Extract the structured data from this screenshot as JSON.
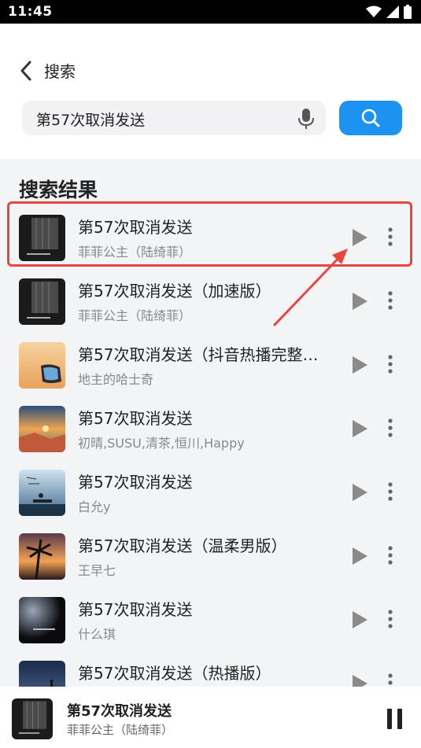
{
  "status_bar": {
    "time": "11:45"
  },
  "header": {
    "back_label": "搜索"
  },
  "search": {
    "query": "第57次取消发送"
  },
  "results_title": "搜索结果",
  "songs": [
    {
      "title": "第57次取消发送",
      "artist": "菲菲公主（陆绮菲）",
      "cover": "dark-window"
    },
    {
      "title": "第57次取消发送（加速版）",
      "artist": "菲菲公主（陆绮菲）",
      "cover": "dark-window"
    },
    {
      "title": "第57次取消发送（抖音热播完整…",
      "artist": "地主的哈士奇",
      "cover": "sunset-mirror"
    },
    {
      "title": "第57次取消发送",
      "artist": "初晴,SUSU,清茶,恒川,Happy",
      "cover": "sea-sunset"
    },
    {
      "title": "第57次取消发送",
      "artist": "白允y",
      "cover": "bench-sky"
    },
    {
      "title": "第57次取消发送（温柔男版）",
      "artist": "王早七",
      "cover": "palm-sunset"
    },
    {
      "title": "第57次取消发送",
      "artist": "什么琪",
      "cover": "dark-light"
    },
    {
      "title": "第57次取消发送（热播版）",
      "artist": "",
      "cover": "night-figure"
    }
  ],
  "player": {
    "title": "第57次取消发送",
    "artist": "菲菲公主（陆绮菲）"
  },
  "colors": {
    "accent": "#1e92f0",
    "highlight": "#e8453c"
  },
  "icons": [
    "back-arrow-icon",
    "mic-icon",
    "search-icon",
    "play-icon",
    "more-vertical-icon",
    "pause-icon",
    "wifi-icon",
    "signal-icon",
    "battery-icon"
  ]
}
